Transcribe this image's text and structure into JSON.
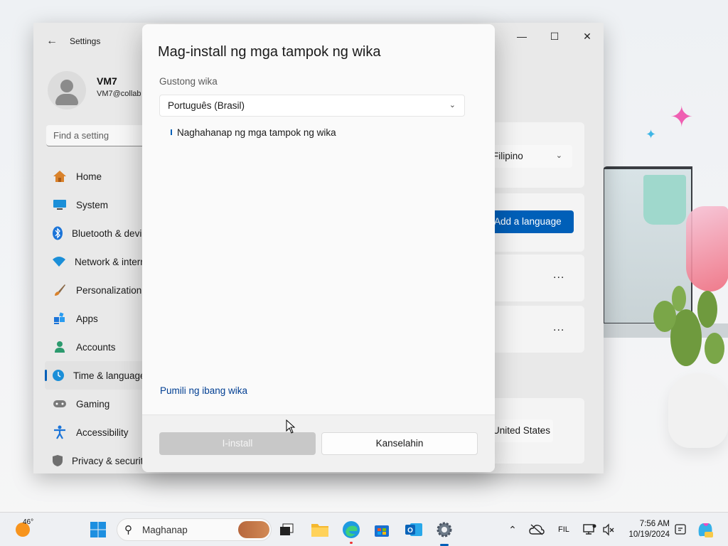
{
  "settings": {
    "window_title": "Settings",
    "user": {
      "name": "VM7",
      "email": "VM7@collab"
    },
    "search_placeholder": "Find a setting",
    "nav": [
      {
        "label": "Home"
      },
      {
        "label": "System"
      },
      {
        "label": "Bluetooth & devices"
      },
      {
        "label": "Network & internet"
      },
      {
        "label": "Personalization"
      },
      {
        "label": "Apps"
      },
      {
        "label": "Accounts"
      },
      {
        "label": "Time & language"
      },
      {
        "label": "Gaming"
      },
      {
        "label": "Accessibility"
      },
      {
        "label": "Privacy & security"
      }
    ],
    "display_language_value": "Filipino",
    "add_language_label": "Add a language",
    "more_dots": "...",
    "region_value": "United States"
  },
  "dialog": {
    "title": "Mag-install ng mga tampok ng wika",
    "preferred_label": "Gustong wika",
    "selected_language": "Português (Brasil)",
    "searching_text": "Naghahanap ng mga tampok ng wika",
    "other_language_link": "Pumili ng ibang wika",
    "install_button": "I-install",
    "cancel_button": "Kanselahin"
  },
  "taskbar": {
    "temperature": "46°",
    "search_placeholder": "Maghanap",
    "language_indicator": "FIL",
    "time": "7:56 AM",
    "date": "10/19/2024"
  },
  "colors": {
    "accent": "#005fb8",
    "link": "#003e92",
    "disabled_button": "#c8c8c8"
  }
}
